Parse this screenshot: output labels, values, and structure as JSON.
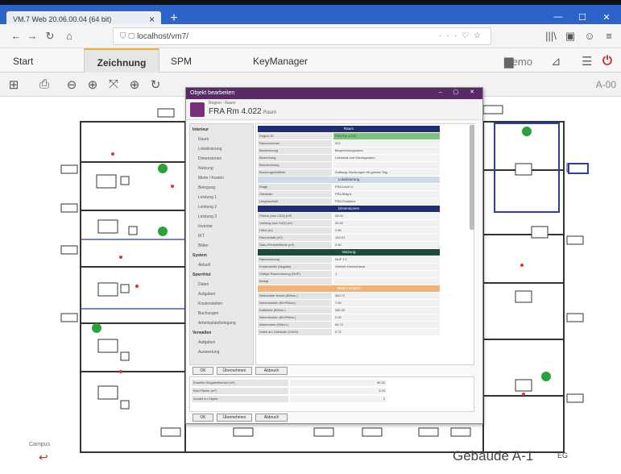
{
  "browser": {
    "tab_title": "VM.7 Web 20.06.00.04 (64 bit)",
    "tab_close": "×",
    "new_tab": "+",
    "window_controls": [
      "—",
      "☐",
      "✕"
    ],
    "url": "localhost/vm7/",
    "url_actions": [
      "···",
      "♡",
      "☆"
    ],
    "right_icons": [
      "|||\\",
      "▣",
      "☺",
      "≡"
    ]
  },
  "menubar": {
    "tabs": [
      "Start",
      "Zeichnung",
      "SPM",
      "KeyManager"
    ],
    "active_tab": "Zeichnung",
    "demo_label": "Demo"
  },
  "toolbar": {
    "sheet_label": "A-00"
  },
  "dialog": {
    "title": "Objekt bearbeiten",
    "subtitle_small": "Region - Raum",
    "object_name": "FRA Rm 4.022",
    "object_suffix": "Raum",
    "sidebar": [
      {
        "label": "Interieur",
        "header": true
      },
      {
        "label": "Raum"
      },
      {
        "label": "Lokalisierung"
      },
      {
        "label": "Dimensionen"
      },
      {
        "label": "Nutzung"
      },
      {
        "label": "Miete / Kosten"
      },
      {
        "label": "Belegung"
      },
      {
        "label": "Leistung 1"
      },
      {
        "label": "Leistung 2"
      },
      {
        "label": "Leistung 3"
      },
      {
        "label": "Inventar"
      },
      {
        "label": "IKT"
      },
      {
        "label": "Bilder"
      },
      {
        "label": "System",
        "header": true
      },
      {
        "label": "Aktuell"
      },
      {
        "label": "Sperrfrist",
        "header": true
      },
      {
        "label": "Daten"
      },
      {
        "label": "Aufgaben"
      },
      {
        "label": "Kostenstellen"
      },
      {
        "label": "Buchungen"
      },
      {
        "label": "Arbeitsplatzbelegung"
      },
      {
        "label": "Verwalten",
        "header": true
      },
      {
        "label": "Aufgaben"
      },
      {
        "label": "Auswertung"
      }
    ],
    "sections": [
      {
        "title": "Raum",
        "color": "#1f2f6e",
        "rows": [
          [
            "Region ID",
            "FRA Rm 4.022"
          ],
          [
            "Raumnummer",
            "022"
          ],
          [
            "Bezeichnung",
            "Besprechungsraum"
          ],
          [
            "Bemerkung",
            "Leitstand und Sitzungsraum"
          ],
          [
            "Beschreibung",
            ""
          ],
          [
            "Buchungsrichtlinie",
            "Zulässig: Buchungen für ganzen Tag"
          ]
        ]
      },
      {
        "title": "Lokalisierung",
        "color": "#d0dae8",
        "rows": [
          [
            "Etage",
            "FRA Level 4"
          ],
          [
            "Gebäude",
            "FRA Bldg A"
          ],
          [
            "Liegenschaft",
            "FRA Frankfurt"
          ]
        ]
      },
      {
        "title": "Dimensionen",
        "color": "#1f2f6e",
        "rows": [
          [
            "Fläche (aus CAD) (m²)",
            "36.04"
          ],
          [
            "Umfang (aus CAD) (m)",
            "24.32"
          ],
          [
            "Höhe (m)",
            "2.80"
          ],
          [
            "Rauminhalt (m³)",
            "100.91"
          ],
          [
            "Glas-/Fensterfläche (m²)",
            "3.40"
          ]
        ]
      },
      {
        "title": "Nutzung",
        "color": "#1b4d3a",
        "rows": [
          [
            "Raumnutzung",
            "NUF 2.1"
          ],
          [
            "Kostenstelle (Abgabe)",
            "Vertrieb Deutschland"
          ],
          [
            "Gültige Raumnutzung (NUF)",
            "1"
          ],
          [
            "Belegt",
            ""
          ]
        ]
      },
      {
        "title": "Miete / Kosten",
        "color": "#f2b27a",
        "rows": [
          [
            "Nettomiete Monat (€/Mon.)",
            "360.72"
          ],
          [
            "Nebenkosten (€/m²/Mon.)",
            "7.50"
          ],
          [
            "Kaltmiete (€/Mon.)",
            "280.30"
          ],
          [
            "Nebenkosten (€/m²/Mon.)",
            "2.00"
          ],
          [
            "Warmmiete (€/Mon.)",
            "64.72"
          ],
          [
            "Anteil am Gebäude (1/000)",
            "0.72"
          ]
        ]
      }
    ],
    "buttons_mid": [
      "OK",
      "Übernehmen",
      "Abbruch"
    ],
    "lower_rows": [
      [
        "Erstellte Eingabeflächen (m²)",
        "36.32"
      ],
      [
        "Brut.Fläche (m²)",
        "3.20"
      ],
      [
        "Anzahl im Objekt",
        "2"
      ]
    ],
    "buttons_bottom": [
      "OK",
      "Übernehmen",
      "Abbruch"
    ]
  },
  "footer": {
    "campus": "Campus",
    "building": "Gebäude A-1",
    "floor": "EG"
  }
}
